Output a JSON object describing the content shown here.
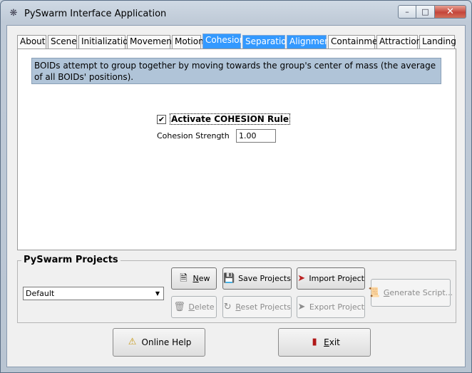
{
  "window": {
    "title": "PySwarm Interface Application",
    "minimize_glyph": "–",
    "maximize_glyph": "□",
    "close_glyph": "✕"
  },
  "tabs": [
    {
      "label": "About",
      "state": "normal"
    },
    {
      "label": "Scene",
      "state": "normal"
    },
    {
      "label": "Initialization",
      "state": "normal"
    },
    {
      "label": "Movement",
      "state": "normal"
    },
    {
      "label": "Motion",
      "state": "normal"
    },
    {
      "label": "Cohesion",
      "state": "selected"
    },
    {
      "label": "Separation",
      "state": "highlighted"
    },
    {
      "label": "Alignment",
      "state": "highlighted"
    },
    {
      "label": "Containment",
      "state": "normal"
    },
    {
      "label": "Attraction",
      "state": "normal"
    },
    {
      "label": "Landing",
      "state": "normal"
    }
  ],
  "cohesion": {
    "description": "BOIDs attempt to group together by moving towards the group's center of mass (the average of all BOIDs' positions).",
    "activate_label": "Activate COHESION Rule",
    "activate_checked": true,
    "check_glyph": "✔",
    "strength_label": "Cohesion Strength",
    "strength_value": "1.00"
  },
  "projects": {
    "group_title": "PySwarm Projects",
    "selected_project": "Default",
    "buttons": {
      "new": {
        "accel": "N",
        "rest": "ew",
        "icon": "new-document-icon",
        "enabled": true
      },
      "save": {
        "label": "Save Projects",
        "icon": "floppy-disk-icon",
        "enabled": true
      },
      "import": {
        "label": "Import Project",
        "icon": "import-icon",
        "enabled": true
      },
      "generate": {
        "accel": "G",
        "rest": "enerate Script...",
        "icon": "script-icon",
        "enabled": false
      },
      "delete": {
        "accel": "D",
        "rest": "elete",
        "icon": "trash-icon",
        "enabled": false
      },
      "reset": {
        "accel": "R",
        "rest": "eset Projects",
        "icon": "reset-icon",
        "enabled": false
      },
      "export": {
        "label": "Export Project",
        "icon": "export-icon",
        "enabled": false
      }
    }
  },
  "footer": {
    "help_label": "Online Help",
    "exit_accel": "E",
    "exit_rest": "xit"
  },
  "colors": {
    "tab_highlight": "#3399ff",
    "description_bg": "#b0c4d8"
  }
}
